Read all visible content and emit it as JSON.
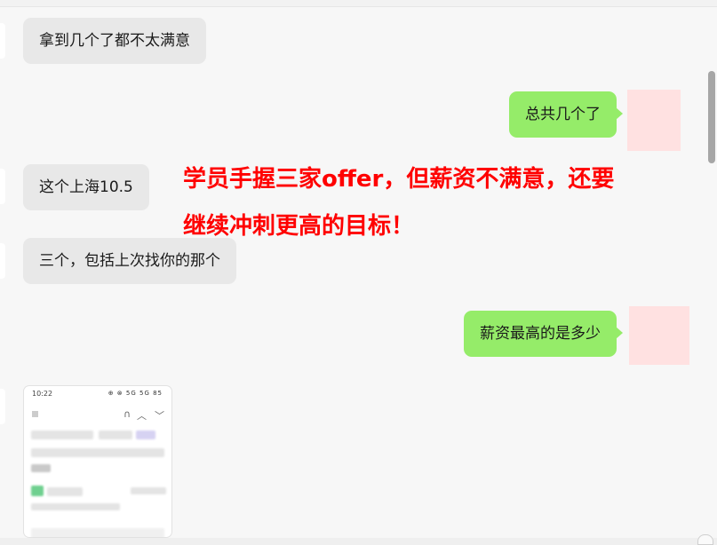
{
  "messages": [
    {
      "side": "in",
      "text": "拿到几个了都不太满意"
    },
    {
      "side": "out",
      "text": "总共几个了"
    },
    {
      "side": "in",
      "text": "这个上海10.5"
    },
    {
      "side": "in",
      "text": "三个，包括上次找你的那个"
    },
    {
      "side": "out",
      "text": "薪资最高的是多少"
    }
  ],
  "annotation": {
    "line1": "学员手握三家offer，但薪资不满意，还要",
    "line2": "继续冲刺更高的目标！",
    "color": "#ff0000"
  },
  "image_message": {
    "status_time": "10:22",
    "status_icons": "⊕ ⊗ 5G 5G 85"
  },
  "colors": {
    "incoming_bubble": "#e8e8e8",
    "outgoing_bubble": "#95ec69",
    "background": "#f7f7f7",
    "avatar_placeholder": "#ffe1e1"
  }
}
